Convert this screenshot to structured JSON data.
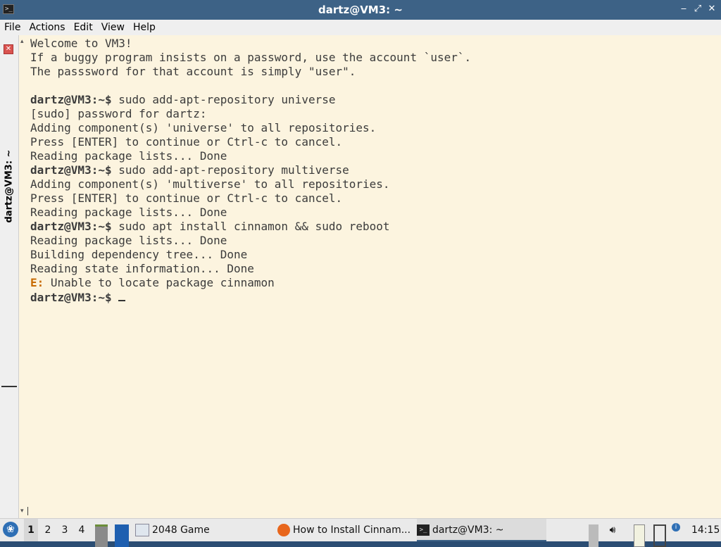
{
  "window": {
    "title": "dartz@VM3: ~"
  },
  "menu": [
    "File",
    "Actions",
    "Edit",
    "View",
    "Help"
  ],
  "tab": {
    "label": "dartz@VM3: ~"
  },
  "terminal": {
    "motd": [
      "Welcome to VM3!",
      "If a buggy program insists on a password, use the account `user`.",
      "The passsword for that account is simply \"user\"."
    ],
    "prompt": "dartz@VM3:~$",
    "cmd1": "sudo add-apt-repository universe",
    "out1": [
      "[sudo] password for dartz:",
      "Adding component(s) 'universe' to all repositories.",
      "Press [ENTER] to continue or Ctrl-c to cancel.",
      "Reading package lists... Done"
    ],
    "cmd2": "sudo add-apt-repository multiverse",
    "out2": [
      "Adding component(s) 'multiverse' to all repositories.",
      "Press [ENTER] to continue or Ctrl-c to cancel.",
      "Reading package lists... Done"
    ],
    "cmd3": "sudo apt install cinnamon && sudo reboot",
    "out3": [
      "Reading package lists... Done",
      "Building dependency tree... Done",
      "Reading state information... Done"
    ],
    "err_prefix": "E:",
    "err_msg": "Unable to locate package cinnamon"
  },
  "taskbar": {
    "desktops": [
      "1",
      "2",
      "3",
      "4"
    ],
    "tasks": {
      "game": "2048 Game",
      "browser": "How to Install Cinnam...",
      "terminal": "dartz@VM3: ~"
    },
    "clock": "14:15"
  },
  "colors": {
    "titlebar": "#3d6286",
    "terminal_bg": "#fcf4df",
    "error": "#c76a00"
  }
}
